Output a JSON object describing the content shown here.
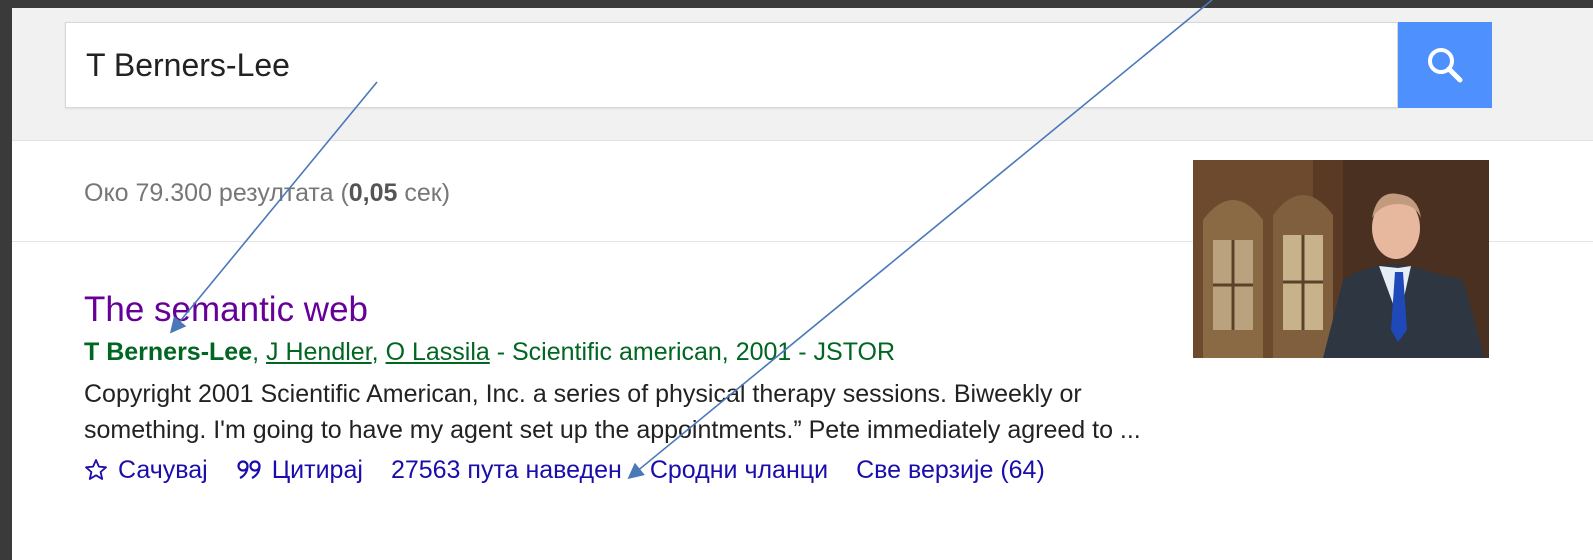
{
  "search": {
    "query": "T Berners-Lee"
  },
  "stats": {
    "prefix": "Око 79.300 резултата (",
    "time": "0,05",
    "suffix": " сек)"
  },
  "result": {
    "title": "The semantic web",
    "authors": {
      "first": "T Berners-Lee",
      "sep1": ", ",
      "second": "J Hendler",
      "sep2": ", ",
      "third": "O Lassila",
      "source": " - Scientific american, 2001 - JSTOR"
    },
    "snippet_line1": "Copyright 2001 Scientific American, Inc. a series of physical therapy sessions. Biweekly or",
    "snippet_line2": "something. I'm going to have my agent set up the appointments.” Pete immediately agreed to ...",
    "actions": {
      "save": "Сачувај",
      "cite": "Цитирај",
      "cited_by": "27563 пута наведен",
      "related": "Сродни чланци",
      "versions": "Све верзије (64)"
    }
  },
  "icons": {
    "search": "search-icon",
    "save": "star-icon",
    "cite": "quote-icon"
  },
  "colors": {
    "search_button": "#4d90fe",
    "title_visited": "#660099",
    "author_green": "#006621",
    "link_blue": "#1a0dab",
    "annotation_arrow": "#4a78b8"
  }
}
